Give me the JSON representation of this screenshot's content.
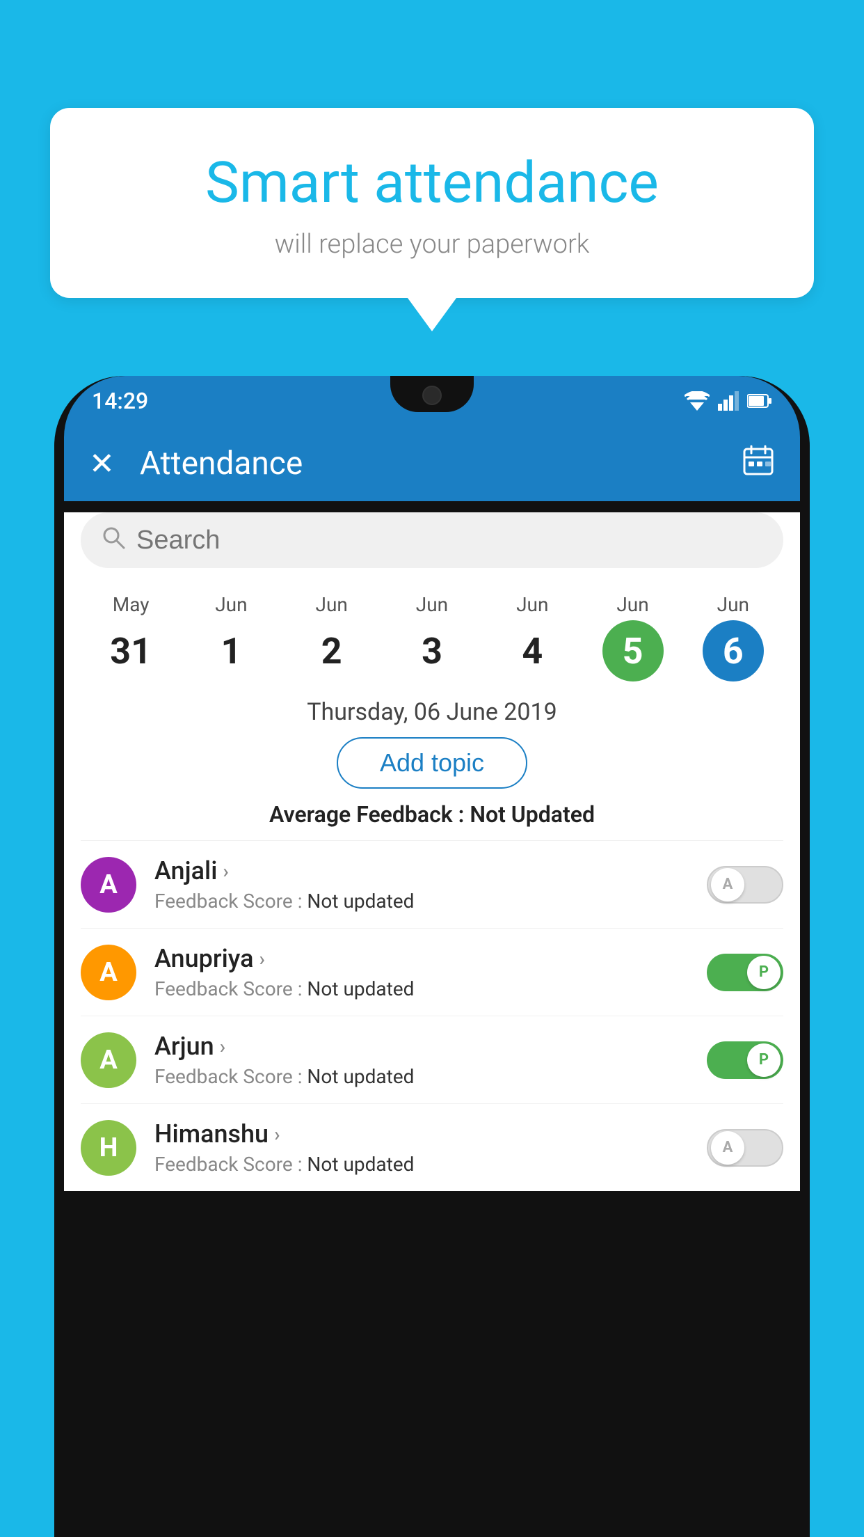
{
  "background_color": "#1ab8e8",
  "bubble": {
    "title": "Smart attendance",
    "subtitle": "will replace your paperwork"
  },
  "status_bar": {
    "time": "14:29",
    "wifi_icon": "wifi",
    "signal_icon": "signal",
    "battery_icon": "battery"
  },
  "app_bar": {
    "title": "Attendance",
    "close_icon": "✕",
    "calendar_icon": "📅"
  },
  "search": {
    "placeholder": "Search"
  },
  "calendar": {
    "days": [
      {
        "month": "May",
        "day": "31",
        "style": "normal"
      },
      {
        "month": "Jun",
        "day": "1",
        "style": "normal"
      },
      {
        "month": "Jun",
        "day": "2",
        "style": "normal"
      },
      {
        "month": "Jun",
        "day": "3",
        "style": "normal"
      },
      {
        "month": "Jun",
        "day": "4",
        "style": "normal"
      },
      {
        "month": "Jun",
        "day": "5",
        "style": "today"
      },
      {
        "month": "Jun",
        "day": "6",
        "style": "selected"
      }
    ]
  },
  "selected_date": "Thursday, 06 June 2019",
  "add_topic_label": "Add topic",
  "avg_feedback_label": "Average Feedback : ",
  "avg_feedback_value": "Not Updated",
  "students": [
    {
      "name": "Anjali",
      "avatar_letter": "A",
      "avatar_color": "#9c27b0",
      "feedback_label": "Feedback Score : ",
      "feedback_value": "Not updated",
      "toggle": "off",
      "toggle_label": "A"
    },
    {
      "name": "Anupriya",
      "avatar_letter": "A",
      "avatar_color": "#ff9800",
      "feedback_label": "Feedback Score : ",
      "feedback_value": "Not updated",
      "toggle": "on",
      "toggle_label": "P"
    },
    {
      "name": "Arjun",
      "avatar_letter": "A",
      "avatar_color": "#8bc34a",
      "feedback_label": "Feedback Score : ",
      "feedback_value": "Not updated",
      "toggle": "on",
      "toggle_label": "P"
    },
    {
      "name": "Himanshu",
      "avatar_letter": "H",
      "avatar_color": "#8bc34a",
      "feedback_label": "Feedback Score : ",
      "feedback_value": "Not updated",
      "toggle": "off",
      "toggle_label": "A"
    }
  ]
}
